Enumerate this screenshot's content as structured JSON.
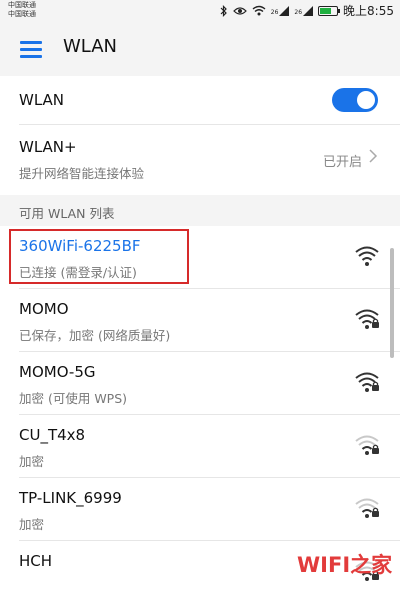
{
  "status_bar": {
    "carrier_1": "中国联通",
    "carrier_2": "中国联通",
    "signal_label_1": "26",
    "signal_label_2": "26",
    "time": "晚上8:55"
  },
  "header": {
    "title": "WLAN"
  },
  "wlan_toggle": {
    "label": "WLAN",
    "enabled": true
  },
  "wlan_plus": {
    "label": "WLAN+",
    "description": "提升网络智能连接体验",
    "status": "已开启"
  },
  "section": {
    "title": "可用 WLAN 列表"
  },
  "networks": [
    {
      "name": "360WiFi-6225BF",
      "status": "已连接 (需登录/认证)",
      "secured": false,
      "strength": 4,
      "connected": true
    },
    {
      "name": "MOMO",
      "status": "已保存，加密 (网络质量好)",
      "secured": true,
      "strength": 4,
      "connected": false
    },
    {
      "name": "MOMO-5G",
      "status": "加密 (可使用 WPS)",
      "secured": true,
      "strength": 4,
      "connected": false
    },
    {
      "name": "CU_T4x8",
      "status": "加密",
      "secured": true,
      "strength": 2,
      "connected": false
    },
    {
      "name": "TP-LINK_6999",
      "status": "加密",
      "secured": true,
      "strength": 2,
      "connected": false
    },
    {
      "name": "HCH",
      "status": "",
      "secured": true,
      "strength": 2,
      "connected": false
    }
  ],
  "watermark": "WIFI之家",
  "colors": {
    "accent": "#1a73e8",
    "highlight_border": "#d62a2a",
    "watermark": "#e23b3b"
  }
}
